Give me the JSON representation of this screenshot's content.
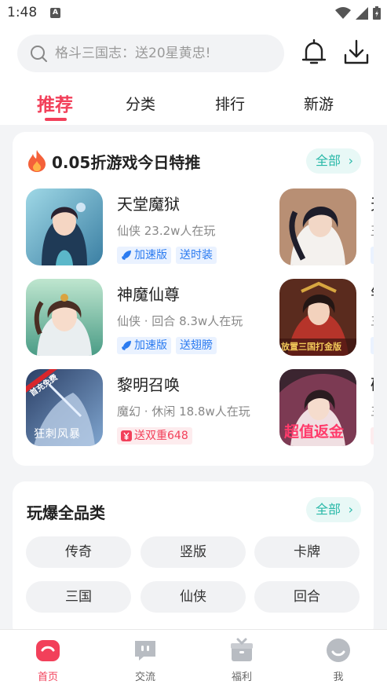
{
  "status_bar": {
    "time": "1:48",
    "a_icon": "A"
  },
  "header": {
    "search_placeholder": "格斗三国志：送20星黄忠!",
    "tabs": [
      {
        "label": "推荐",
        "active": true
      },
      {
        "label": "分类",
        "active": false
      },
      {
        "label": "排行",
        "active": false
      },
      {
        "label": "新游",
        "active": false
      }
    ]
  },
  "featured": {
    "title": "0.05折游戏今日特推",
    "all_label": "全部",
    "games": [
      {
        "name": "天堂魔狱",
        "meta": "仙侠  23.2w人在玩",
        "tags": [
          {
            "label": "加速版",
            "icon": "rocket-icon"
          },
          {
            "label": "送时装"
          }
        ]
      },
      {
        "name": "神魔仙尊",
        "meta": "仙侠 · 回合  8.3w人在玩",
        "tags": [
          {
            "label": "加速版",
            "icon": "rocket-icon"
          },
          {
            "label": "送翅膀"
          }
        ]
      },
      {
        "name": "黎明召唤",
        "meta": "魔幻 · 休闲  18.8w人在玩",
        "tags": [
          {
            "label": "送双重648",
            "icon": "yen-icon",
            "style": "red"
          }
        ]
      }
    ],
    "thumb_texts": {
      "game3": "首充免费",
      "game3_sub": "狂刺风暴",
      "right2": "放置三国打金版",
      "right3": "超值返金"
    },
    "right_column": [
      {
        "name": "天",
        "meta": "玉"
      },
      {
        "name": "钅",
        "meta": "三"
      },
      {
        "name": "砧",
        "meta": "三"
      }
    ]
  },
  "categories": {
    "title": "玩爆全品类",
    "all_label": "全部",
    "items": [
      "传奇",
      "竖版",
      "卡牌",
      "三国",
      "仙侠",
      "回合"
    ]
  },
  "bottom_nav": [
    {
      "label": "首页",
      "icon": "home-icon",
      "active": true
    },
    {
      "label": "交流",
      "icon": "chat-icon",
      "active": false
    },
    {
      "label": "福利",
      "icon": "gift-icon",
      "active": false
    },
    {
      "label": "我",
      "icon": "profile-icon",
      "active": false
    }
  ],
  "colors": {
    "accent": "#f2405a",
    "teal": "#28b8a8",
    "blue_tag": "#2b7bf0"
  }
}
